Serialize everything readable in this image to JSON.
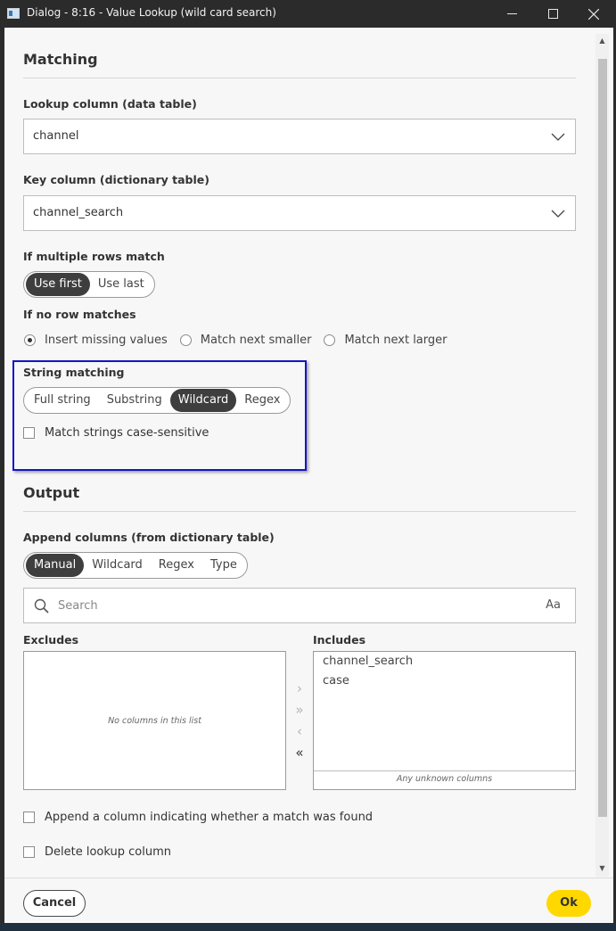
{
  "window": {
    "title": "Dialog - 8:16 - Value Lookup (wild card search)",
    "minimize_icon": "minimize-icon",
    "maximize_icon": "maximize-icon",
    "close_icon": "close-icon"
  },
  "matching": {
    "heading": "Matching",
    "lookup_column": {
      "label": "Lookup column (data table)",
      "value": "channel"
    },
    "key_column": {
      "label": "Key column (dictionary table)",
      "value": "channel_search"
    },
    "multiple_rows": {
      "label": "If multiple rows match",
      "options": [
        "Use first",
        "Use last"
      ],
      "selected": "Use first"
    },
    "no_row": {
      "label": "If no row matches",
      "options": [
        "Insert missing values",
        "Match next smaller",
        "Match next larger"
      ],
      "selected": "Insert missing values"
    },
    "string_matching": {
      "label": "String matching",
      "options": [
        "Full string",
        "Substring",
        "Wildcard",
        "Regex"
      ],
      "selected": "Wildcard",
      "case_sensitive_label": "Match strings case-sensitive",
      "case_sensitive_checked": false
    }
  },
  "output": {
    "heading": "Output",
    "append_label": "Append columns (from dictionary table)",
    "append_modes": [
      "Manual",
      "Wildcard",
      "Regex",
      "Type"
    ],
    "append_selected": "Manual",
    "search_placeholder": "Search",
    "case_toggle": "Aa",
    "excludes": {
      "label": "Excludes",
      "empty_text": "No columns in this list",
      "items": []
    },
    "includes": {
      "label": "Includes",
      "items": [
        "channel_search",
        "case"
      ],
      "unknown_text": "Any unknown columns"
    },
    "append_found_label": "Append a column indicating whether a match was found",
    "delete_lookup_label": "Delete lookup column"
  },
  "footer": {
    "cancel": "Cancel",
    "ok": "Ok"
  },
  "colors": {
    "ok_button": "#ffd800",
    "highlight_box": "#1414c8",
    "segment_active": "#3e3e3e"
  }
}
